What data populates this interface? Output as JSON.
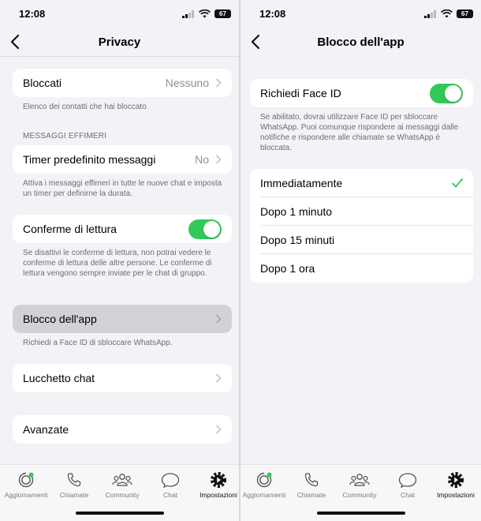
{
  "status": {
    "time": "12:08",
    "battery": "67"
  },
  "left": {
    "title": "Privacy",
    "blocked": {
      "label": "Bloccati",
      "value": "Nessuno",
      "note": "Elenco dei contatti che hai bloccato"
    },
    "ephemeral_header": "MESSAGGI EFFIMERI",
    "timer": {
      "label": "Timer predefinito messaggi",
      "value": "No",
      "note": "Attiva i messaggi effimeri in tutte le nuove chat e imposta un timer per definirne la durata."
    },
    "read_receipts": {
      "label": "Conferme di lettura",
      "enabled": true,
      "note": "Se disattivi le conferme di lettura, non potrai vedere le conferme di lettura delle altre persone. Le conferme di lettura vengono sempre inviate per le chat di gruppo."
    },
    "app_lock": {
      "label": "Blocco dell'app",
      "note": "Richiedi a Face ID di sbloccare WhatsApp."
    },
    "chat_lock": {
      "label": "Lucchetto chat"
    },
    "advanced": {
      "label": "Avanzate"
    }
  },
  "right": {
    "title": "Blocco dell'app",
    "faceid": {
      "label": "Richiedi Face ID",
      "enabled": true,
      "note": "Se abilitato, dovrai utilizzare Face ID per sbloccare WhatsApp. Puoi comunque rispondere ai messaggi dalle notifiche e rispondere alle chiamate se WhatsApp è bloccata."
    },
    "options": [
      {
        "label": "Immediatamente",
        "checked": true
      },
      {
        "label": "Dopo 1 minuto",
        "checked": false
      },
      {
        "label": "Dopo 15 minuti",
        "checked": false
      },
      {
        "label": "Dopo 1 ora",
        "checked": false
      }
    ]
  },
  "tabs": [
    {
      "label": "Aggiornamenti",
      "icon": "updates-icon"
    },
    {
      "label": "Chiamate",
      "icon": "phone-icon"
    },
    {
      "label": "Community",
      "icon": "community-icon"
    },
    {
      "label": "Chat",
      "icon": "chat-icon"
    },
    {
      "label": "Impostazioni",
      "icon": "settings-gear-icon",
      "active": true
    }
  ],
  "colors": {
    "accent": "#34c759",
    "selected_row": "#d1d1d6",
    "background": "#f2f2f7"
  }
}
